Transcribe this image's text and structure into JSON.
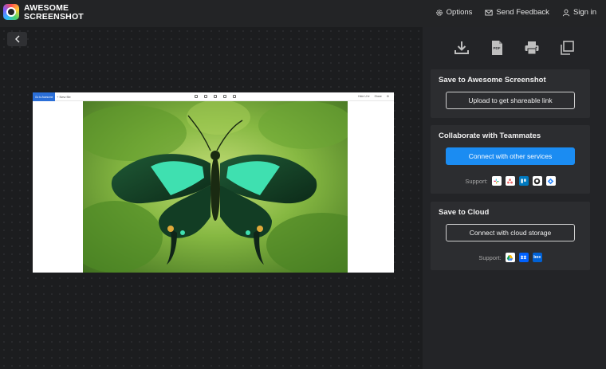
{
  "app": {
    "brand_line1": "AWESOME",
    "brand_line2": "SCREENSHOT"
  },
  "topnav": {
    "options": "Options",
    "feedback": "Send Feedback",
    "signin": "Sign in"
  },
  "preview": {
    "badge": "Go to Awesome",
    "new": "+ New file",
    "right1": "Hide UI ▾",
    "right2": "Share"
  },
  "actions": [
    {
      "icon": "download-icon"
    },
    {
      "icon": "pdf-icon"
    },
    {
      "icon": "print-icon"
    },
    {
      "icon": "copy-icon"
    }
  ],
  "cards": {
    "save": {
      "title": "Save to Awesome Screenshot",
      "button": "Upload to get shareable link"
    },
    "collaborate": {
      "title": "Collaborate with Teammates",
      "button": "Connect with other services",
      "support_label": "Support:",
      "services": [
        "slack-icon",
        "asana-icon",
        "trello-icon",
        "github-icon",
        "jira-icon"
      ]
    },
    "cloud": {
      "title": "Save to Cloud",
      "button": "Connect with cloud storage",
      "support_label": "Support:",
      "services": [
        "google-drive-icon",
        "dropbox-icon",
        "box-icon"
      ]
    }
  },
  "colors": {
    "accent": "#1b8cf2",
    "panel": "#232427",
    "card": "#2c2d30"
  }
}
